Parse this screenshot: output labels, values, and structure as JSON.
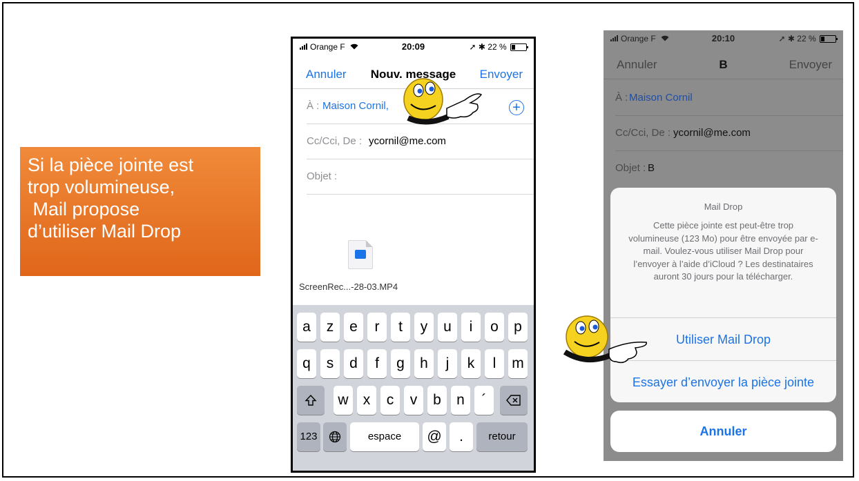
{
  "callout": {
    "lines": [
      "Si la pièce jointe est",
      "trop volumineuse,",
      " Mail propose",
      "d’utiliser Mail Drop"
    ]
  },
  "phone1": {
    "status": {
      "carrier": "Orange F",
      "time": "20:09",
      "battery": "22 %"
    },
    "nav": {
      "cancel": "Annuler",
      "title": "Nouv. message",
      "send": "Envoyer"
    },
    "to": {
      "label": "À :",
      "value": "Maison Cornil,"
    },
    "cc": {
      "label": "Cc/Cci, De :",
      "value": "ycornil@me.com"
    },
    "subject": {
      "label": "Objet :"
    },
    "attachment": {
      "name": "ScreenRec...-28-03.MP4",
      "icon": "video-file-icon"
    },
    "keyboard": {
      "row1": [
        "a",
        "z",
        "e",
        "r",
        "t",
        "y",
        "u",
        "i",
        "o",
        "p"
      ],
      "row2": [
        "q",
        "s",
        "d",
        "f",
        "g",
        "h",
        "j",
        "k",
        "l",
        "m"
      ],
      "row3": [
        "w",
        "x",
        "c",
        "v",
        "b",
        "n",
        "´"
      ],
      "numbers": "123",
      "space": "espace",
      "at": "@",
      "dot": ".",
      "return": "retour"
    }
  },
  "phone2": {
    "status": {
      "carrier": "Orange F",
      "time": "20:10",
      "battery": "22 %"
    },
    "nav": {
      "cancel": "Annuler",
      "title": "B",
      "send": "Envoyer"
    },
    "to": {
      "label": "À :",
      "value": "Maison Cornil"
    },
    "cc": {
      "label": "Cc/Cci, De :",
      "value": "ycornil@me.com"
    },
    "subject": {
      "label": "Objet :",
      "value": "B"
    },
    "sheet": {
      "title": "Mail Drop",
      "message": "Cette pièce jointe est peut-être trop volumineuse (123 Mo) pour être envoyée par e-mail. Voulez-vous utiliser Mail Drop pour l’envoyer à l’aide d’iCloud ? Les destinataires auront 30 jours pour la télécharger.",
      "use_mail_drop": "Utiliser Mail Drop",
      "try_send": "Essayer d’envoyer la pièce jointe",
      "cancel": "Annuler"
    }
  },
  "colors": {
    "ios_blue": "#1a73e8",
    "callout_orange": "#e8732a"
  }
}
